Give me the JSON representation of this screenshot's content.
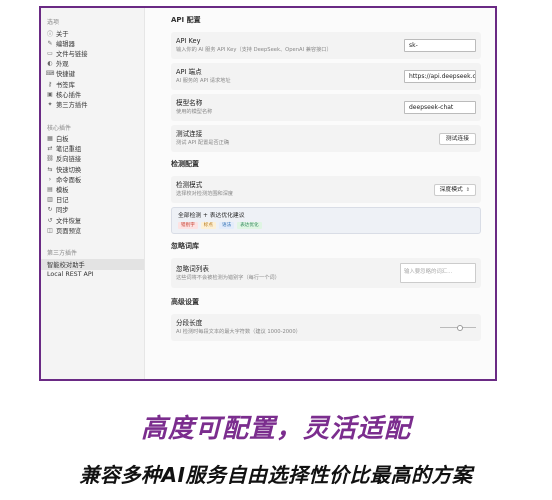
{
  "sidebar": {
    "section_options": "选项",
    "options_items": [
      {
        "label": "关于",
        "icon": "info-icon"
      },
      {
        "label": "编辑器",
        "icon": "edit-icon"
      },
      {
        "label": "文件与链接",
        "icon": "folder-icon"
      },
      {
        "label": "外观",
        "icon": "palette-icon"
      },
      {
        "label": "快捷键",
        "icon": "keyboard-icon"
      },
      {
        "label": "书签库",
        "icon": "key-icon"
      },
      {
        "label": "核心插件",
        "icon": "plugin-icon"
      },
      {
        "label": "第三方插件",
        "icon": "puzzle-icon"
      }
    ],
    "section_core": "核心插件",
    "core_items": [
      {
        "label": "白板",
        "icon": "grid-icon"
      },
      {
        "label": "笔记重组",
        "icon": "arrows-icon"
      },
      {
        "label": "反向链接",
        "icon": "link-icon"
      },
      {
        "label": "快速切换",
        "icon": "switch-icon"
      },
      {
        "label": "命令面板",
        "icon": "terminal-icon"
      },
      {
        "label": "模板",
        "icon": "template-icon"
      },
      {
        "label": "日记",
        "icon": "calendar-icon"
      },
      {
        "label": "同步",
        "icon": "sync-icon"
      },
      {
        "label": "文件恢复",
        "icon": "history-icon"
      },
      {
        "label": "页面预览",
        "icon": "preview-icon"
      }
    ],
    "section_third": "第三方插件",
    "third_items": [
      {
        "label": "智能校对助手",
        "active": true
      },
      {
        "label": "Local REST API",
        "active": false
      }
    ]
  },
  "main": {
    "api_section": "API 配置",
    "api_key": {
      "label": "API Key",
      "desc": "输入你的 AI 服务 API Key（支持 DeepSeek、OpenAI 兼容接口）",
      "value": "sk-"
    },
    "endpoint": {
      "label": "API 端点",
      "desc": "AI 服务的 API 请求地址",
      "value": "https://api.deepseek.com"
    },
    "model": {
      "label": "模型名称",
      "desc": "使用的模型名称",
      "value": "deepseek-chat"
    },
    "test": {
      "label": "测试连接",
      "desc": "测试 API 配置是否正确",
      "button": "测试连接"
    },
    "detect_section": "检测配置",
    "mode": {
      "label": "检测模式",
      "desc": "选择校对检测范围和深度",
      "value": "深度模式"
    },
    "strategy": {
      "title": "全部检测 + 表达优化建议",
      "badges": [
        {
          "label": "错别字",
          "bg": "#fde2e2",
          "fg": "#c0392b"
        },
        {
          "label": "标点",
          "bg": "#fdf0d5",
          "fg": "#b7791f"
        },
        {
          "label": "语法",
          "bg": "#e3ecfb",
          "fg": "#2b6cb0"
        },
        {
          "label": "表达优化",
          "bg": "#dff5e3",
          "fg": "#2f855a"
        }
      ]
    },
    "ignore_section": "忽略词库",
    "ignore": {
      "label": "忽略词列表",
      "desc": "这些词将不会被检测为错别字（每行一个词）",
      "placeholder": "输入要忽略的词汇..."
    },
    "advanced_section": "高级设置",
    "chunk": {
      "label": "分段长度",
      "desc": "AI 检测时每段文本的最大字符数（建议 1000-2000）",
      "fraction": 0.55
    }
  },
  "taglines": {
    "line1": "高度可配置，灵活适配",
    "line2": "兼容多种AI服务自由选择性价比最高的方案"
  }
}
